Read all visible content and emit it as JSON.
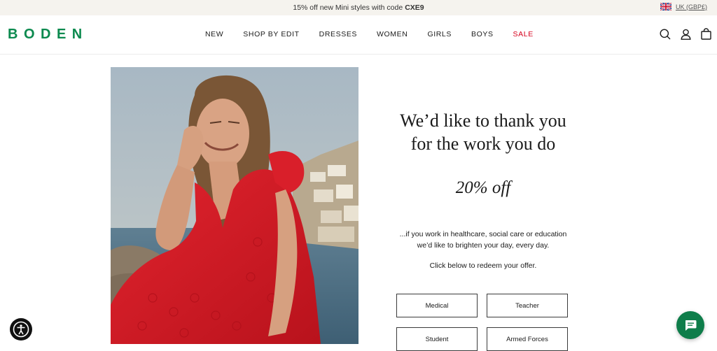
{
  "promo": {
    "text": "15% off new Mini styles with code",
    "code": "CXE9"
  },
  "locale": {
    "label": "UK (GBP£)",
    "flag": "uk-flag-icon"
  },
  "brand": {
    "logo": "BODEN",
    "color": "#0c8a4f"
  },
  "nav": [
    {
      "label": "NEW"
    },
    {
      "label": "SHOP BY EDIT"
    },
    {
      "label": "DRESSES"
    },
    {
      "label": "WOMEN"
    },
    {
      "label": "GIRLS"
    },
    {
      "label": "BOYS"
    },
    {
      "label": "SALE",
      "color": "#d6001c"
    }
  ],
  "header_icons": [
    "search-icon",
    "account-icon",
    "bag-icon"
  ],
  "hero": {
    "headline_line1": "We’d like to thank you",
    "headline_line2": "for the work you do",
    "offer": "20% off",
    "body_line1": "...if you work in healthcare, social care or education",
    "body_line2": "we’d like to brighten your day, every day.",
    "cta_text": "Click below to redeem your offer."
  },
  "buttons": {
    "medical": "Medical",
    "teacher": "Teacher",
    "student": "Student",
    "armed_forces": "Armed Forces"
  },
  "widgets": {
    "accessibility": "accessibility-icon",
    "chat": "chat-icon",
    "chat_color": "#0e7d4a"
  }
}
